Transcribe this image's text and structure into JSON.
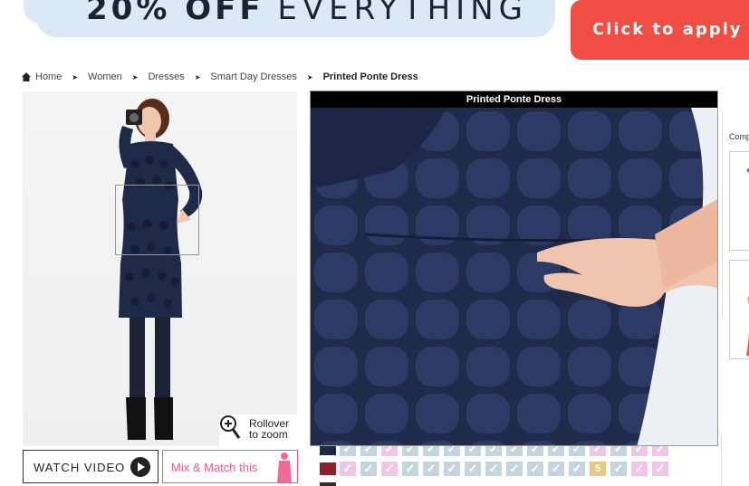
{
  "promo": {
    "headline_bold": "20% OFF",
    "headline_light": "EVERYTHING",
    "apply_label": "Click to apply th"
  },
  "breadcrumb": {
    "items": [
      "Home",
      "Women",
      "Dresses",
      "Smart Day Dresses"
    ],
    "current": "Printed Ponte Dress"
  },
  "product": {
    "rollover_hint": [
      "Rollover",
      "to zoom"
    ]
  },
  "buttons": {
    "watch_video": "WATCH VIDEO",
    "mix_match": "Mix & Match this"
  },
  "zoom": {
    "title": "Printed Ponte Dress"
  },
  "compare": {
    "label": "Comp"
  },
  "size_grid": {
    "low_stock_value": "5"
  },
  "colors": {
    "navy": "#1f2a48",
    "promo_bg": "#dbe9f6",
    "apply_red": "#f04d45",
    "mix_pink": "#e85b8b"
  }
}
